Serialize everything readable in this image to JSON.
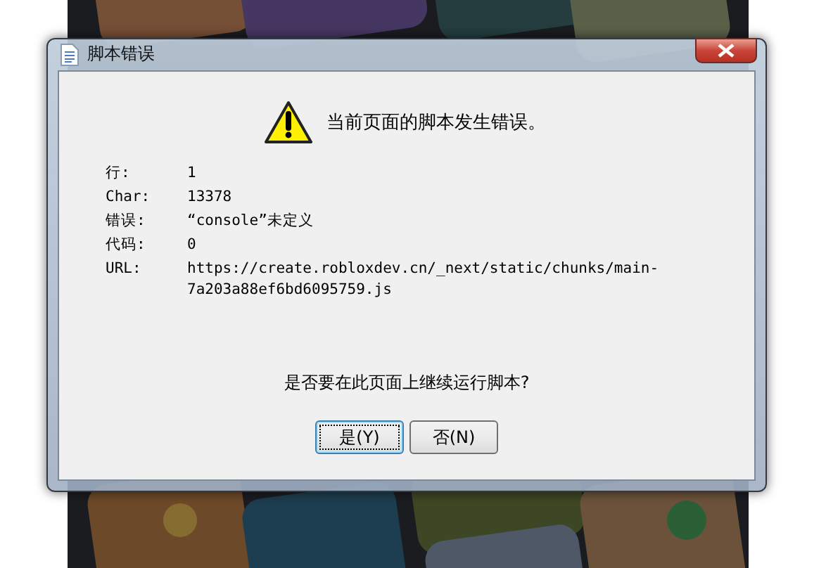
{
  "window": {
    "title": "脚本错误"
  },
  "message": "当前页面的脚本发生错误。",
  "details": [
    {
      "label": "行:",
      "value": "1"
    },
    {
      "label": "Char:",
      "value": "13378"
    },
    {
      "label": "错误:",
      "value": "“console”未定义"
    },
    {
      "label": "代码:",
      "value": "0"
    },
    {
      "label": "URL:",
      "value": "https://create.robloxdev.cn/_next/static/chunks/main-7a203a88ef6bd6095759.js"
    }
  ],
  "question": "是否要在此页面上继续运行脚本?",
  "buttons": [
    {
      "label": "是(Y)",
      "focused": true
    },
    {
      "label": "否(N)",
      "focused": false
    }
  ]
}
